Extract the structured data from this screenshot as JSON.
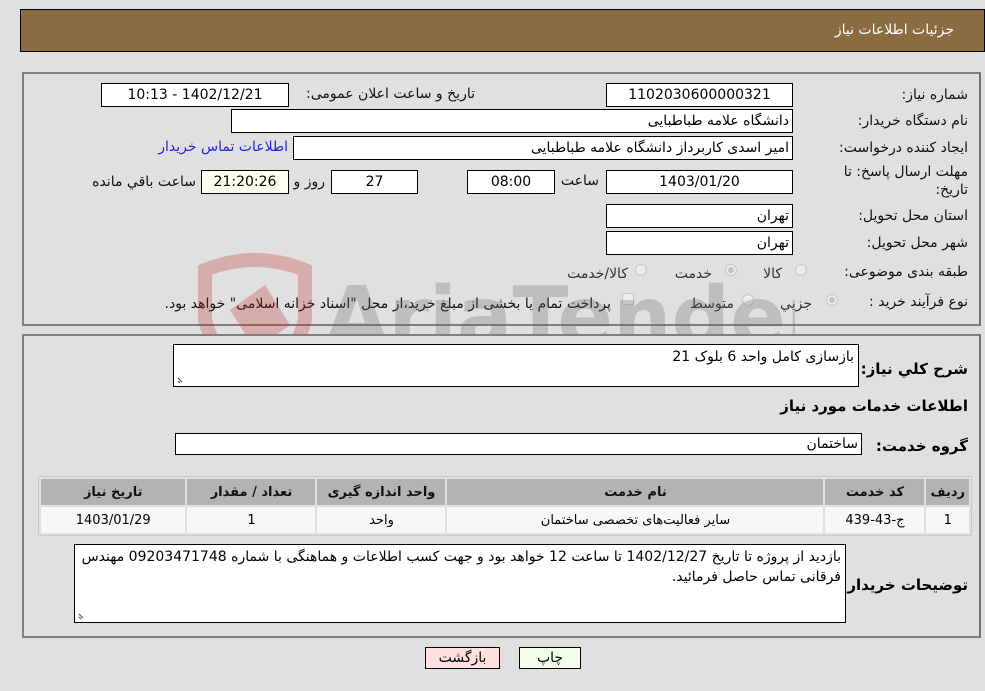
{
  "header": {
    "title": "جزئیات اطلاعات نیاز"
  },
  "form": {
    "need_number": {
      "label": "شماره نیاز:",
      "value": "1102030600000321"
    },
    "announce_datetime": {
      "label": "تاریخ و ساعت اعلان عمومی:",
      "value": "1402/12/21 - 10:13"
    },
    "buyer_org": {
      "label": "نام دستگاه خریدار:",
      "value": "دانشگاه علامه طباطبایی"
    },
    "requester": {
      "label": "ایجاد کننده درخواست:",
      "value": "امیر اسدی کاربرداز دانشگاه علامه طباطبایی"
    },
    "buyer_contact_link": "اطلاعات تماس خریدار",
    "deadline": {
      "label_line1": "مهلت ارسال پاسخ: تا",
      "label_line2": "تاریخ:",
      "date": "1403/01/20",
      "time_label": "ساعت",
      "time": "08:00",
      "days": "27",
      "days_label": "روز و",
      "remaining": "21:20:26",
      "remaining_label": "ساعت باقي مانده"
    },
    "province": {
      "label": "استان محل تحویل:",
      "value": "تهران"
    },
    "city": {
      "label": "شهر محل تحویل:",
      "value": "تهران"
    },
    "category": {
      "label": "طبقه بندی موضوعی:",
      "options": [
        "کالا",
        "خدمت",
        "کالا/خدمت"
      ],
      "selected": "خدمت"
    },
    "purchase_type": {
      "label": "نوع فرآیند خرید :",
      "options": [
        "جزيي",
        "متوسط"
      ],
      "selected": "جزيي",
      "treasury_note": "پرداخت تمام یا بخشی از مبلغ خرید،از محل \"اسناد خزانه اسلامی\" خواهد بود."
    }
  },
  "details": {
    "description_label": "شرح کلي نیاز:",
    "description": "بازسازی کامل واحد 6 بلوک 21",
    "services_heading": "اطلاعات خدمات مورد نیاز",
    "service_group_label": "گروه خدمت:",
    "service_group": "ساختمان",
    "table": {
      "headers": [
        "ردیف",
        "کد خدمت",
        "نام خدمت",
        "واحد اندازه گیری",
        "تعداد / مقدار",
        "تاریخ نیاز"
      ],
      "rows": [
        [
          "1",
          "ج-43-439",
          "سایر فعالیت‌های تخصصی ساختمان",
          "واحد",
          "1",
          "1403/01/29"
        ]
      ]
    },
    "buyer_notes_label": "توضیحات خریدار:",
    "buyer_notes": "بازدید از پروژه تا تاریخ 1402/12/27 تا ساعت 12 خواهد بود و جهت کسب اطلاعات و هماهنگی با شماره 09203471748 مهندس فرقانی تماس حاصل فرمائید."
  },
  "buttons": {
    "print": "چاپ",
    "back": "بازگشت"
  },
  "colors": {
    "header_bg": "#8b6c42",
    "link": "#1d25d4",
    "print_bg": "#f0ffe8",
    "back_bg": "#ffe0e0"
  },
  "watermark": {
    "text": "AriaTender.neT"
  }
}
